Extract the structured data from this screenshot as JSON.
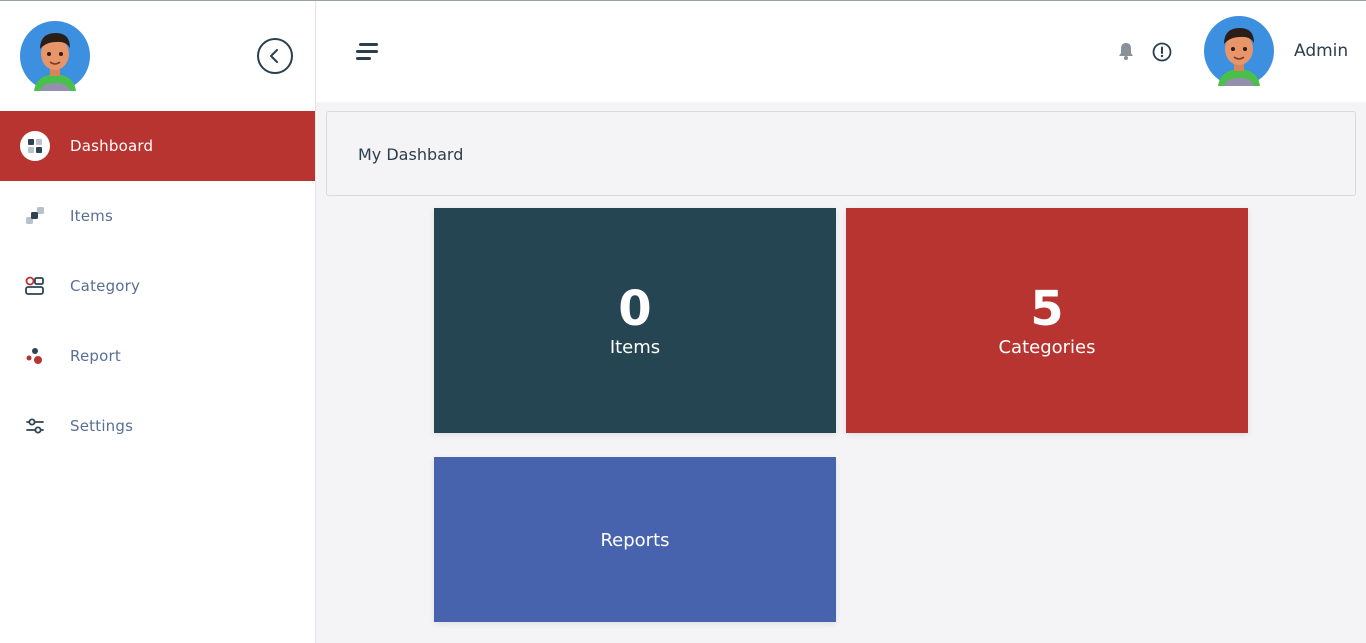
{
  "sidebar": {
    "items": [
      {
        "label": "Dashboard",
        "icon": "dashboard-icon",
        "active": true
      },
      {
        "label": "Items",
        "icon": "items-icon",
        "active": false
      },
      {
        "label": "Category",
        "icon": "category-icon",
        "active": false
      },
      {
        "label": "Report",
        "icon": "report-icon",
        "active": false
      },
      {
        "label": "Settings",
        "icon": "settings-icon",
        "active": false
      }
    ]
  },
  "header": {
    "username": "Admin",
    "icons": [
      "menu-icon",
      "bell-icon",
      "alert-icon",
      "avatar"
    ]
  },
  "main": {
    "page_title": "My Dashbard",
    "cards": [
      {
        "value": "0",
        "label": "Items",
        "color": "#264552"
      },
      {
        "value": "5",
        "label": "Categories",
        "color": "#b83430"
      },
      {
        "value": "",
        "label": "Reports",
        "color": "#4763ae"
      }
    ]
  },
  "colors": {
    "accent": "#b83430",
    "dark": "#264552",
    "blue": "#4763ae",
    "nav_text": "#5a6f95"
  }
}
